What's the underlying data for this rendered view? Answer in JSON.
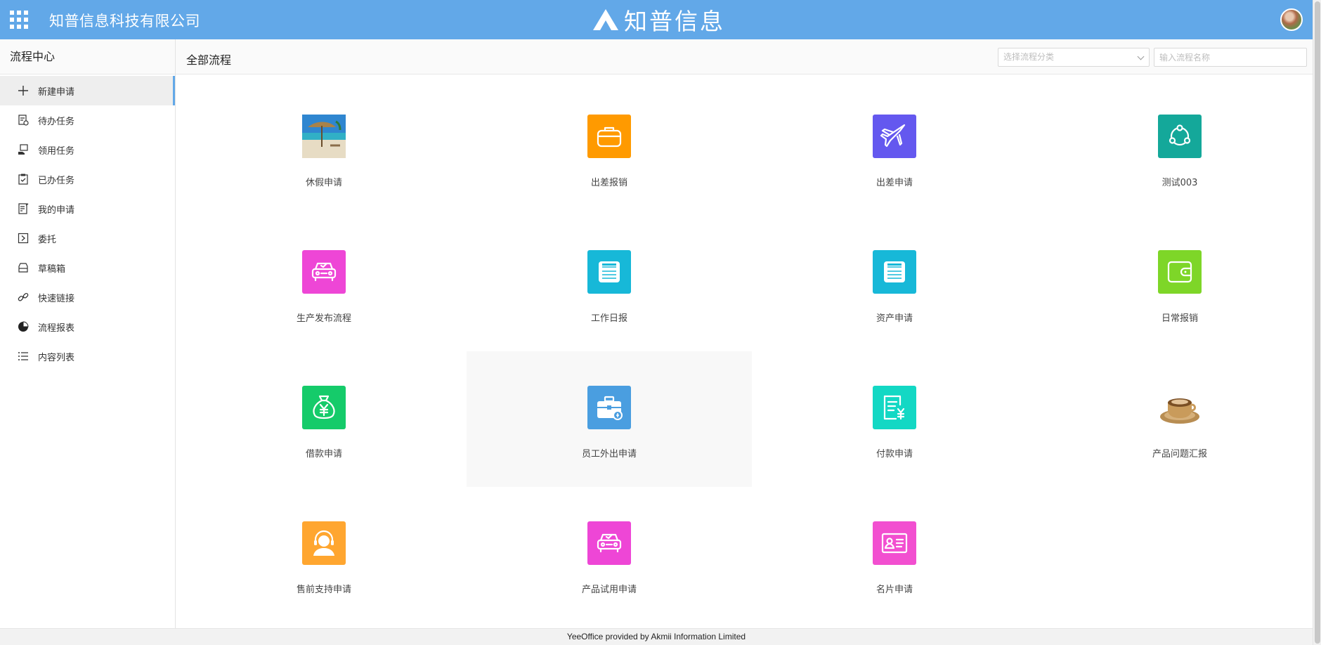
{
  "header": {
    "company_name": "知普信息科技有限公司",
    "brand_text": "知普信息",
    "accent_color": "#62a8e8"
  },
  "sidebar": {
    "title": "流程中心",
    "items": [
      {
        "label": "新建申请",
        "icon": "plus-icon",
        "active": true
      },
      {
        "label": "待办任务",
        "icon": "todo-doc-icon"
      },
      {
        "label": "领用任务",
        "icon": "hand-task-icon"
      },
      {
        "label": "已办任务",
        "icon": "clipboard-check-icon"
      },
      {
        "label": "我的申请",
        "icon": "edit-doc-icon"
      },
      {
        "label": "委托",
        "icon": "delegate-icon"
      },
      {
        "label": "草稿箱",
        "icon": "inbox-icon"
      },
      {
        "label": "快速链接",
        "icon": "link-icon"
      },
      {
        "label": "流程报表",
        "icon": "pie-chart-icon"
      },
      {
        "label": "内容列表",
        "icon": "list-icon"
      }
    ]
  },
  "main": {
    "title": "全部流程",
    "category_select": {
      "placeholder": "选择流程分类"
    },
    "search": {
      "placeholder": "输入流程名称"
    },
    "processes": [
      {
        "label": "休假申请",
        "icon": "beach-photo-icon",
        "color": "#3a8fc9"
      },
      {
        "label": "出差报销",
        "icon": "suitcase-icon",
        "color": "#ff9a00"
      },
      {
        "label": "出差申请",
        "icon": "airplane-icon",
        "color": "#6458ef"
      },
      {
        "label": "测试003",
        "icon": "share-circle-icon",
        "color": "#14a89a"
      },
      {
        "label": "生产发布流程",
        "icon": "car-check-icon",
        "color": "#ee46d6"
      },
      {
        "label": "工作日报",
        "icon": "report-doc-icon",
        "color": "#17b8d8"
      },
      {
        "label": "资产申请",
        "icon": "report-doc-icon",
        "color": "#17b8d8"
      },
      {
        "label": "日常报销",
        "icon": "wallet-icon",
        "color": "#7ed628"
      },
      {
        "label": "借款申请",
        "icon": "money-bag-icon",
        "color": "#15cb6a"
      },
      {
        "label": "员工外出申请",
        "icon": "briefcase-coin-icon",
        "color": "#4a9ee0"
      },
      {
        "label": "付款申请",
        "icon": "invoice-yen-icon",
        "color": "#13d8c4"
      },
      {
        "label": "产品问题汇报",
        "icon": "coffee-photo-icon",
        "color": "#b98a44"
      },
      {
        "label": "售前支持申请",
        "icon": "headset-person-icon",
        "color": "#ffa630"
      },
      {
        "label": "产品试用申请",
        "icon": "car-check-icon",
        "color": "#ee46d6"
      },
      {
        "label": "名片申请",
        "icon": "id-card-icon",
        "color": "#f24fd0"
      }
    ]
  },
  "footer": {
    "text": "YeeOffice provided by Akmii Information Limited"
  }
}
